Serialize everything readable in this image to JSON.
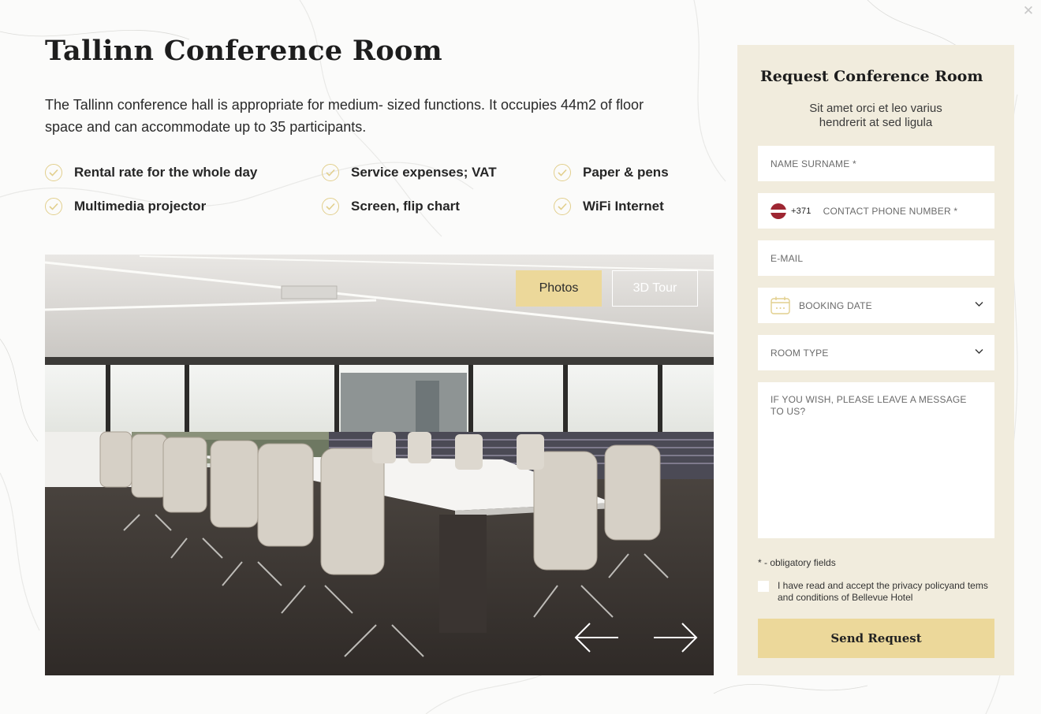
{
  "page": {
    "close_icon": "close-icon",
    "title": "Tallinn Conference Room",
    "description": "The Tallinn conference hall is appropriate for medium- sized functions. It occupies 44m2 of floor space and can accommodate up to 35 participants."
  },
  "features": [
    {
      "label": "Rental rate for the whole day",
      "icon": "check-circle-icon"
    },
    {
      "label": "Service expenses; VAT",
      "icon": "check-circle-icon"
    },
    {
      "label": "Paper & pens",
      "icon": "check-circle-icon"
    },
    {
      "label": "Multimedia projector",
      "icon": "check-circle-icon"
    },
    {
      "label": "Screen, flip chart",
      "icon": "check-circle-icon"
    },
    {
      "label": "WiFi Internet",
      "icon": "check-circle-icon"
    }
  ],
  "gallery": {
    "tab_photos": "Photos",
    "tab_3d_tour": "3D Tour",
    "active_tab": "Photos",
    "prev_icon": "arrow-left-icon",
    "next_icon": "arrow-right-icon"
  },
  "form": {
    "title": "Request Conference Room",
    "subtitle": "Sit amet orci et leo varius hendrerit at sed ligula",
    "name_placeholder": "NAME SURNAME *",
    "phone_dial_code": "+371",
    "phone_flag": "latvia-flag-icon",
    "phone_placeholder": "CONTACT PHONE NUMBER *",
    "email_placeholder": "E-MAIL",
    "booking_date_placeholder": "BOOKING DATE",
    "room_type_placeholder": "ROOM TYPE",
    "message_placeholder": "IF YOU WISH, PLEASE LEAVE A MESSAGE TO US?",
    "obligatory_note": "* - obligatory fields",
    "consent_text": "I have read and accept the privacy policyand tems and conditions of Bellevue Hotel",
    "submit_label": "Send Request"
  },
  "colors": {
    "accent_gold": "#ecd89a",
    "panel_bg": "#f1ecdd",
    "check_stroke": "#e2cf8d",
    "flag_red": "#9e2632"
  }
}
